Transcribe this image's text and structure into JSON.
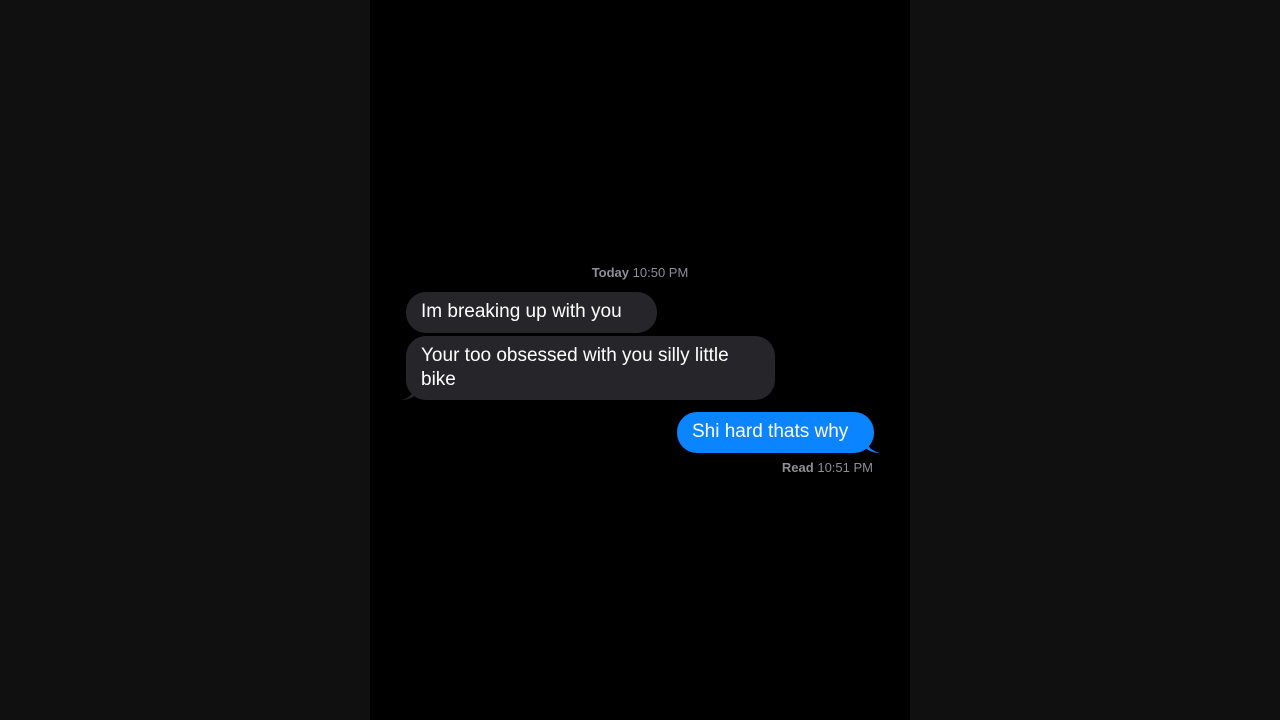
{
  "conversation": {
    "timestamp": {
      "day": "Today",
      "time": "10:50 PM"
    },
    "messages": [
      {
        "direction": "incoming",
        "text": "Im breaking up with you"
      },
      {
        "direction": "incoming",
        "text": "Your too obsessed with you silly little bike"
      },
      {
        "direction": "outgoing",
        "text": "Shi hard thats why"
      }
    ],
    "receipt": {
      "label": "Read",
      "time": "10:51 PM"
    }
  },
  "colors": {
    "incoming_bubble": "#26252a",
    "outgoing_bubble": "#0a84ff",
    "background": "#000000",
    "meta_text": "#8e8e93"
  }
}
